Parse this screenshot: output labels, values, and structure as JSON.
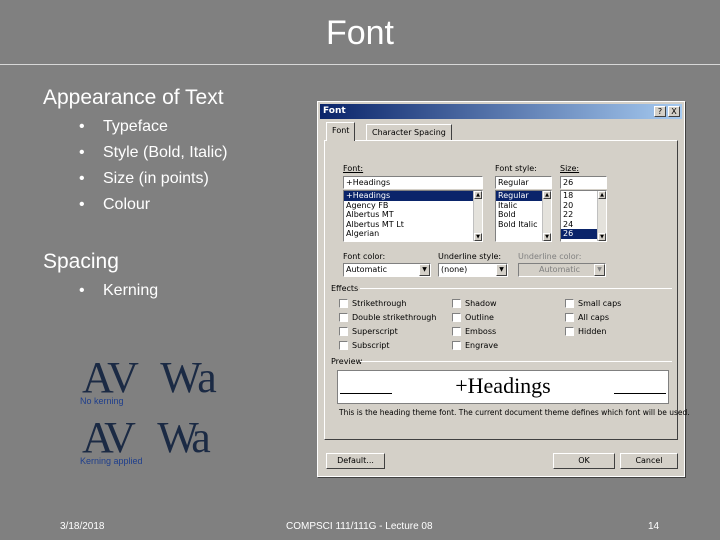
{
  "slide": {
    "title": "Font",
    "heading_appearance": "Appearance of Text",
    "appearance_items": [
      "Typeface",
      "Style (Bold, Italic)",
      "Size (in points)",
      "Colour"
    ],
    "heading_spacing": "Spacing",
    "spacing_items": [
      "Kerning"
    ],
    "kerning_sample_text": "AV Wa",
    "kerning_caption_no": "No kerning",
    "kerning_caption_yes": "Kerning applied"
  },
  "footer": {
    "date": "3/18/2018",
    "course": "COMPSCI 111/111G - Lecture 08",
    "page": "14"
  },
  "dialog": {
    "title": "Font",
    "help_btn": "?",
    "close_btn": "X",
    "tabs": [
      "Font",
      "Character Spacing"
    ],
    "font_label": "Font:",
    "font_value": "+Headings",
    "font_list": [
      "+Headings",
      "Agency FB",
      "Albertus MT",
      "Albertus MT Lt",
      "Algerian"
    ],
    "style_label": "Font style:",
    "style_value": "Regular",
    "style_list": [
      "Regular",
      "Italic",
      "Bold",
      "Bold Italic"
    ],
    "size_label": "Size:",
    "size_value": "26",
    "size_list": [
      "18",
      "20",
      "22",
      "24",
      "26"
    ],
    "font_color_label": "Font color:",
    "font_color_value": "Automatic",
    "underline_style_label": "Underline style:",
    "underline_style_value": "(none)",
    "underline_color_label": "Underline color:",
    "underline_color_value": "Automatic",
    "effects_label": "Effects",
    "effects": [
      "Strikethrough",
      "Shadow",
      "Small caps",
      "Double strikethrough",
      "Outline",
      "All caps",
      "Superscript",
      "Emboss",
      "Hidden",
      "Subscript",
      "Engrave"
    ],
    "preview_label": "Preview",
    "preview_text": "+Headings",
    "preview_note": "This is the heading theme font. The current document theme defines which font will be used.",
    "default_btn": "Default...",
    "ok_btn": "OK",
    "cancel_btn": "Cancel"
  }
}
